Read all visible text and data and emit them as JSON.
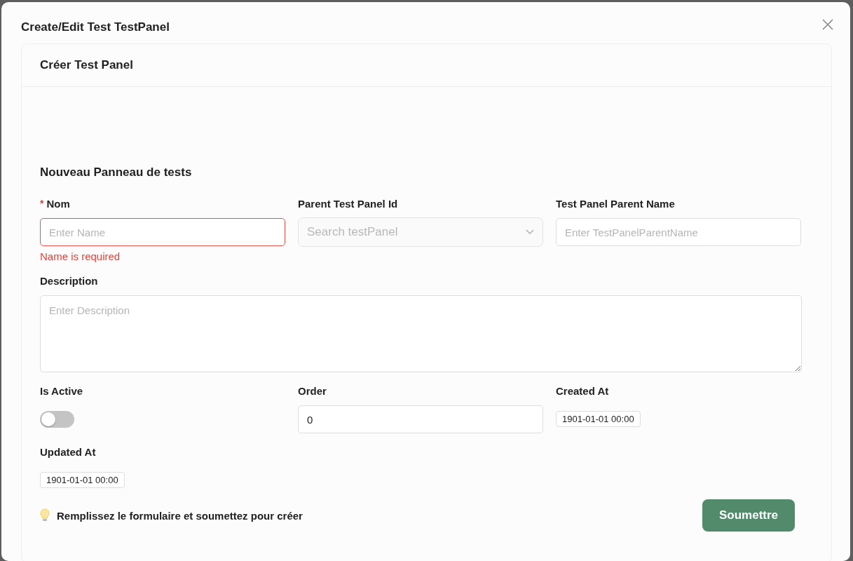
{
  "dialog": {
    "title": "Create/Edit Test TestPanel"
  },
  "card": {
    "title": "Créer Test Panel"
  },
  "form": {
    "title": "Nouveau Panneau de tests",
    "fields": [
      {
        "kind": "input",
        "label": "Nom",
        "required_mark": "*",
        "placeholder": "Enter Name",
        "error": "Name is required"
      },
      {
        "kind": "select",
        "label": "Parent Test Panel Id",
        "placeholder": "Search testPanel"
      },
      {
        "kind": "input",
        "label": "Test Panel Parent Name",
        "placeholder": "Enter TestPanelParentName"
      },
      {
        "kind": "textarea",
        "label": "Description",
        "placeholder": "Enter Description"
      },
      {
        "kind": "switch",
        "label": "Is Active",
        "on": false
      },
      {
        "kind": "input",
        "label": "Order",
        "value": "0"
      },
      {
        "kind": "timestamp",
        "label": "Created At",
        "value": "1901-01-01 00:00"
      },
      {
        "kind": "timestamp",
        "label": "Updated At",
        "value": "1901-01-01 00:00"
      }
    ]
  },
  "footer": {
    "hint": "Remplissez le formulaire et soumettez pour créer",
    "submit": "Soumettre"
  }
}
